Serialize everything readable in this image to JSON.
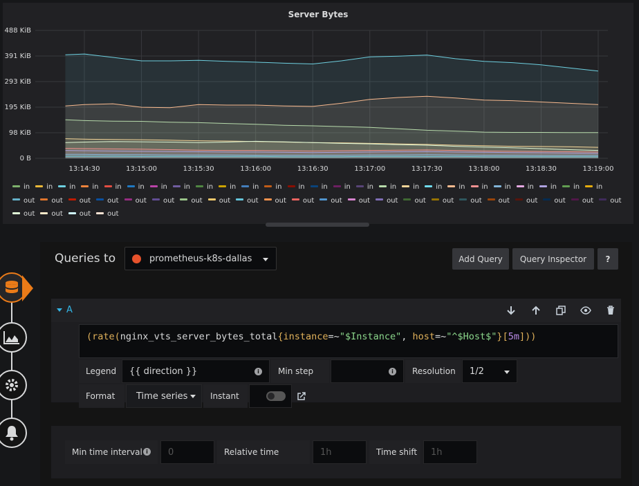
{
  "panel": {
    "title": "Server Bytes",
    "y_ticks": [
      "488 KiB",
      "391 KiB",
      "293 KiB",
      "195 KiB",
      "98 KiB",
      "0 B"
    ],
    "x_ticks": [
      "13:14:30",
      "13:15:00",
      "13:15:30",
      "13:16:00",
      "13:16:30",
      "13:17:00",
      "13:17:30",
      "13:18:00",
      "13:18:30",
      "13:19:00"
    ],
    "legend": [
      {
        "label": "in",
        "color": "#7eb26d"
      },
      {
        "label": "in",
        "color": "#eab839"
      },
      {
        "label": "in",
        "color": "#6ed0e0"
      },
      {
        "label": "in",
        "color": "#ef843c"
      },
      {
        "label": "in",
        "color": "#e24d42"
      },
      {
        "label": "in",
        "color": "#1f78c1"
      },
      {
        "label": "in",
        "color": "#ba43a9"
      },
      {
        "label": "in",
        "color": "#705da0"
      },
      {
        "label": "in",
        "color": "#508642"
      },
      {
        "label": "in",
        "color": "#cca300"
      },
      {
        "label": "in",
        "color": "#447ebc"
      },
      {
        "label": "in",
        "color": "#c15c17"
      },
      {
        "label": "in",
        "color": "#890f02"
      },
      {
        "label": "in",
        "color": "#0a437c"
      },
      {
        "label": "in",
        "color": "#6d1f62"
      },
      {
        "label": "in",
        "color": "#584477"
      },
      {
        "label": "in",
        "color": "#b7dbab"
      },
      {
        "label": "in",
        "color": "#f4d598"
      },
      {
        "label": "in",
        "color": "#70dbed"
      },
      {
        "label": "in",
        "color": "#f9ba8f"
      },
      {
        "label": "in",
        "color": "#f29191"
      },
      {
        "label": "in",
        "color": "#82b5d8"
      },
      {
        "label": "in",
        "color": "#e5a8e2"
      },
      {
        "label": "in",
        "color": "#aea2e0"
      },
      {
        "label": "in",
        "color": "#629e51"
      },
      {
        "label": "in",
        "color": "#e5ac0e"
      },
      {
        "label": "out",
        "color": "#64b0c8"
      },
      {
        "label": "out",
        "color": "#e0752d"
      },
      {
        "label": "out",
        "color": "#bf1b00"
      },
      {
        "label": "out",
        "color": "#0a50a1"
      },
      {
        "label": "out",
        "color": "#962d82"
      },
      {
        "label": "out",
        "color": "#614d93"
      },
      {
        "label": "out",
        "color": "#9ac48a"
      },
      {
        "label": "out",
        "color": "#f2c96d"
      },
      {
        "label": "out",
        "color": "#65c5db"
      },
      {
        "label": "out",
        "color": "#f9934e"
      },
      {
        "label": "out",
        "color": "#ea6460"
      },
      {
        "label": "out",
        "color": "#5195ce"
      },
      {
        "label": "out",
        "color": "#d683ce"
      },
      {
        "label": "out",
        "color": "#806eb7"
      },
      {
        "label": "out",
        "color": "#3f6833"
      },
      {
        "label": "out",
        "color": "#967302"
      },
      {
        "label": "out",
        "color": "#2f575e"
      },
      {
        "label": "out",
        "color": "#99440a"
      },
      {
        "label": "out",
        "color": "#58140c"
      },
      {
        "label": "out",
        "color": "#052b51"
      },
      {
        "label": "out",
        "color": "#511749"
      },
      {
        "label": "out",
        "color": "#3f2b5b"
      },
      {
        "label": "out",
        "color": "#e0f9d7"
      },
      {
        "label": "out",
        "color": "#fceaca"
      },
      {
        "label": "out",
        "color": "#cffaff"
      },
      {
        "label": "out",
        "color": "#f9e2d2"
      }
    ]
  },
  "chart_data": {
    "type": "area",
    "title": "Server Bytes",
    "y_unit": "KiB",
    "ylim": [
      0,
      488
    ],
    "x": [
      "13:14:20",
      "13:14:30",
      "13:14:45",
      "13:15:00",
      "13:15:15",
      "13:15:30",
      "13:15:45",
      "13:16:00",
      "13:16:15",
      "13:16:30",
      "13:16:45",
      "13:17:00",
      "13:17:15",
      "13:17:30",
      "13:17:45",
      "13:18:00",
      "13:18:15",
      "13:18:30",
      "13:18:45",
      "13:19:00"
    ],
    "series": [
      {
        "color": "#6ed0e0",
        "values": [
          395,
          398,
          385,
          372,
          372,
          374,
          370,
          367,
          363,
          360,
          372,
          387,
          390,
          394,
          380,
          370,
          365,
          357,
          345,
          333
        ]
      },
      {
        "color": "#f9ba8f",
        "values": [
          200,
          205,
          208,
          195,
          193,
          205,
          203,
          203,
          200,
          198,
          210,
          225,
          232,
          237,
          230,
          222,
          220,
          215,
          210,
          205
        ]
      },
      {
        "color": "#b7dbab",
        "values": [
          147,
          144,
          142,
          141,
          138,
          136,
          133,
          130,
          126,
          124,
          121,
          118,
          113,
          107,
          104,
          100,
          99,
          99,
          98,
          98
        ]
      },
      {
        "color": "#f4d598",
        "values": [
          75,
          73,
          72,
          71,
          69,
          67,
          66,
          64,
          62,
          60,
          59,
          57,
          55,
          53,
          50,
          48,
          46,
          45,
          44,
          42
        ]
      },
      {
        "color": "#e0f9d7",
        "values": [
          60,
          62,
          64,
          63,
          62,
          60,
          62,
          65,
          63,
          60,
          57,
          55,
          52,
          50,
          46,
          43,
          40,
          37,
          33,
          30
        ]
      },
      {
        "color": "#f29191",
        "values": [
          38,
          37,
          36,
          35,
          33,
          31,
          30,
          30,
          29,
          28,
          29,
          30,
          31,
          32,
          30,
          28,
          27,
          26,
          25,
          24
        ]
      },
      {
        "color": "#aea2e0",
        "values": [
          30,
          29,
          28,
          27,
          26,
          25,
          24,
          24,
          23,
          22,
          23,
          24,
          25,
          26,
          24,
          23,
          22,
          21,
          20,
          19
        ]
      },
      {
        "color": "#82b5d8",
        "values": [
          15,
          15,
          14,
          14,
          13,
          13,
          13,
          12,
          12,
          12,
          12,
          13,
          13,
          14,
          13,
          12,
          12,
          11,
          11,
          11
        ]
      },
      {
        "color": "#6ed0e0",
        "values": [
          8,
          8,
          8,
          7,
          7,
          7,
          7,
          7,
          6,
          6,
          6,
          7,
          7,
          7,
          7,
          6,
          6,
          6,
          6,
          6
        ]
      }
    ]
  },
  "editor": {
    "queries_to": "Queries to",
    "datasource": "prometheus-k8s-dallas",
    "add_query": "Add Query",
    "query_inspector": "Query Inspector",
    "help": "?",
    "query": {
      "letter": "A",
      "expr": {
        "fn": "rate",
        "open": "(",
        "metric": "nginx_vts_server_bytes_total",
        "lbrace": "{",
        "label1": "instance",
        "op1": "=~",
        "val1": "\"$Instance\"",
        "comma": ", ",
        "label2": "host",
        "op2": "=~",
        "val2": "\"^$Host$\"",
        "rbrace": "}",
        "range_open": "[",
        "range": "5m",
        "range_close": "]",
        "close": "))"
      },
      "legend_label": "Legend",
      "legend_value": "{{ direction }}",
      "min_step_label": "Min step",
      "resolution_label": "Resolution",
      "resolution_value": "1/2",
      "format_label": "Format",
      "format_value": "Time series",
      "instant_label": "Instant"
    },
    "options": {
      "min_time_interval_label": "Min time interval",
      "min_time_interval_placeholder": "0",
      "relative_time_label": "Relative time",
      "relative_time_placeholder": "1h",
      "time_shift_label": "Time shift",
      "time_shift_placeholder": "1h"
    }
  }
}
